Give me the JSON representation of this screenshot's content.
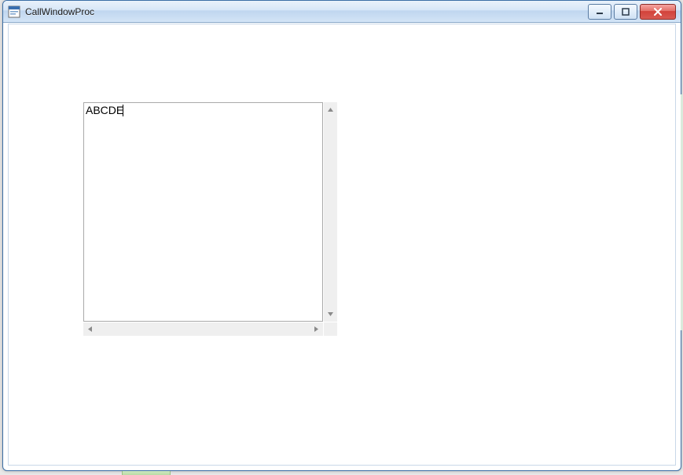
{
  "window": {
    "title": "CallWindowProc"
  },
  "editor": {
    "content": "ABCDE"
  }
}
